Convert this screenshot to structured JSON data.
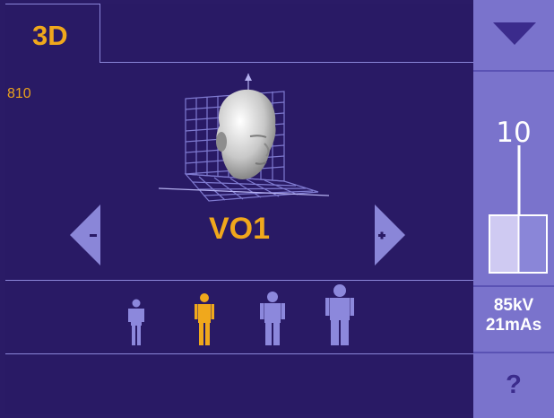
{
  "tab": {
    "label": "3D"
  },
  "counter": "810",
  "mode": {
    "label": "VO1"
  },
  "level": {
    "value": "10",
    "fill_fraction": 0.5
  },
  "technique": {
    "kv": "85kV",
    "mas": "21mAs"
  },
  "help_label": "?",
  "patient_sizes": {
    "options": [
      "child",
      "small-adult",
      "medium-adult",
      "large-adult"
    ],
    "selected": "small-adult"
  },
  "colors": {
    "background": "#291a65",
    "accent": "#f0a81c",
    "sidebar": "#7a73cc",
    "figure_inactive": "#8c88dc",
    "line": "#8a86d8"
  }
}
